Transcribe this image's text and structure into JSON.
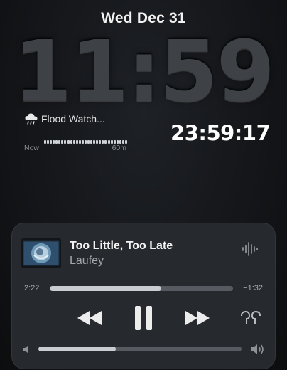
{
  "lock": {
    "date": "Wed Dec 31",
    "time": "11:59"
  },
  "widgets": {
    "weather": {
      "icon": "rain-cloud-icon",
      "title": "Flood Watch...",
      "label_start": "Now",
      "label_end": "60m",
      "precip_levels": [
        0.6,
        0.6,
        0.6,
        0.6,
        0.6,
        0.6,
        0.6,
        0.6,
        0.6,
        0.6,
        0.6,
        0.6,
        0.6,
        0.6,
        0.6,
        0.6,
        0.6,
        0.6,
        0.6,
        0.6,
        0.6,
        0.6,
        0.6,
        0.6,
        0.6,
        0.6,
        0.6,
        0.6,
        0.6
      ]
    },
    "stopwatch": "23:59:17"
  },
  "now_playing": {
    "title": "Too Little, Too Late",
    "artist": "Laufey",
    "elapsed": "2:22",
    "remaining": "−1:32",
    "progress_fraction": 0.61,
    "volume_fraction": 0.38,
    "icons": {
      "waveform": "waveform-icon",
      "rewind": "rewind-icon",
      "pause": "pause-icon",
      "forward": "fast-forward-icon",
      "airpods": "airpods-icon",
      "volume_low": "speaker-low-icon",
      "volume_high": "speaker-high-icon"
    }
  },
  "colors": {
    "background": "#141619",
    "panel": "#282b30",
    "accent": "#c9ccd0"
  }
}
